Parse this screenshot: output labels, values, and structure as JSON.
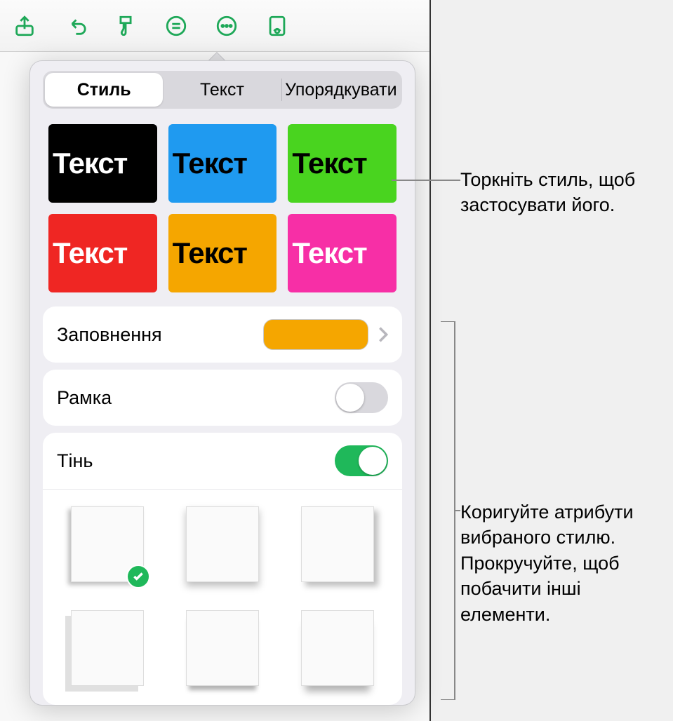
{
  "toolbar_icons": [
    "share",
    "undo",
    "format",
    "list",
    "more",
    "read"
  ],
  "tabs": {
    "style": "Стиль",
    "text": "Текст",
    "arrange": "Упорядкувати",
    "selected": "style"
  },
  "swatch_label": "Текст",
  "swatches": [
    {
      "bg": "#000000",
      "fg": "#ffffff"
    },
    {
      "bg": "#1f9af0",
      "fg": "#000000"
    },
    {
      "bg": "#49d41f",
      "fg": "#000000"
    },
    {
      "bg": "#ef2623",
      "fg": "#ffffff"
    },
    {
      "bg": "#f5a600",
      "fg": "#000000"
    },
    {
      "bg": "#f72fa6",
      "fg": "#ffffff"
    }
  ],
  "fill": {
    "label": "Заповнення",
    "color": "#f5a600"
  },
  "border": {
    "label": "Рамка",
    "on": false
  },
  "shadow": {
    "label": "Тінь",
    "on": true,
    "selected": 0
  },
  "callouts": {
    "apply": "Торкніть стиль, щоб застосувати його.",
    "adjust": "Коригуйте атрибути вибраного стилю. Прокручуйте, щоб побачити інші елементи."
  }
}
